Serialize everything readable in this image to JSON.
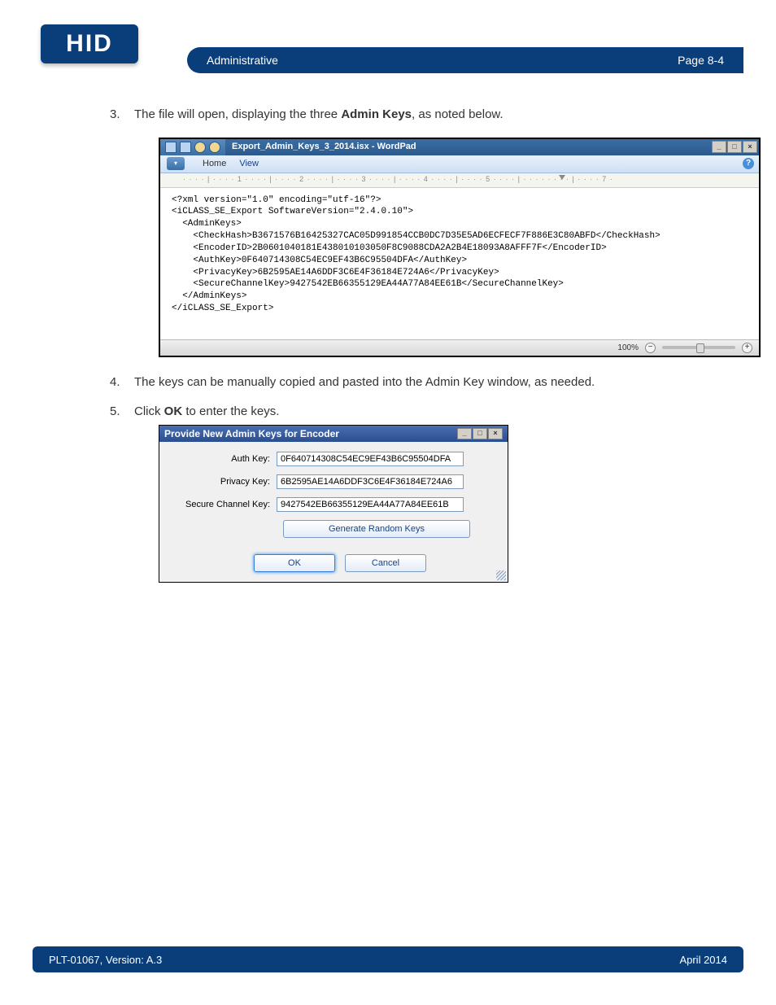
{
  "header": {
    "logo": "HID",
    "section": "Administrative",
    "page_label": "Page 8-4"
  },
  "steps": {
    "s3_pre": "The file will open, displaying the three ",
    "s3_bold": "Admin Keys",
    "s3_post": ", as noted below.",
    "s4": "The keys can be manually copied and pasted into the Admin Key window, as needed.",
    "s5_pre": "Click ",
    "s5_bold": "OK",
    "s5_post": " to enter the keys."
  },
  "wordpad": {
    "title": "Export_Admin_Keys_3_2014.isx - WordPad",
    "tabs": {
      "home": "Home",
      "view": "View"
    },
    "ruler": "· · · · | · · · · 1 · · · · | · · · · 2 · · · · | · · · · 3 · · · · | · · · · 4 · · · · | · · · · 5 · · · · | · · · ·   · · · · | · · · · 7 ·",
    "zoom": "100%",
    "winctrl": {
      "min": "_",
      "max": "□",
      "close": "×"
    },
    "help": "?",
    "xml": "<?xml version=\"1.0\" encoding=\"utf-16\"?>\n<iCLASS_SE_Export SoftwareVersion=\"2.4.0.10\">\n  <AdminKeys>\n    <CheckHash>B3671576B16425327CAC05D991854CCB0DC7D35E5AD6ECFECF7F886E3C80ABFD</CheckHash>\n    <EncoderID>2B0601040181E438010103050F8C9088CDA2A2B4E18093A8AFFF7F</EncoderID>\n    <AuthKey>0F640714308C54EC9EF43B6C95504DFA</AuthKey>\n    <PrivacyKey>6B2595AE14A6DDF3C6E4F36184E724A6</PrivacyKey>\n    <SecureChannelKey>9427542EB66355129EA44A77A84EE61B</SecureChannelKey>\n  </AdminKeys>\n</iCLASS_SE_Export>"
  },
  "dialog": {
    "title": "Provide New Admin Keys for Encoder",
    "winctrl": {
      "min": "_",
      "max": "□",
      "close": "×"
    },
    "labels": {
      "auth": "Auth Key:",
      "privacy": "Privacy Key:",
      "secure": "Secure Channel Key:"
    },
    "values": {
      "auth": "0F640714308C54EC9EF43B6C95504DFA",
      "privacy": "6B2595AE14A6DDF3C6E4F36184E724A6",
      "secure": "9427542EB66355129EA44A77A84EE61B"
    },
    "buttons": {
      "generate": "Generate Random Keys",
      "ok": "OK",
      "cancel": "Cancel"
    }
  },
  "footer": {
    "left": "PLT-01067, Version: A.3",
    "right": "April 2014"
  }
}
